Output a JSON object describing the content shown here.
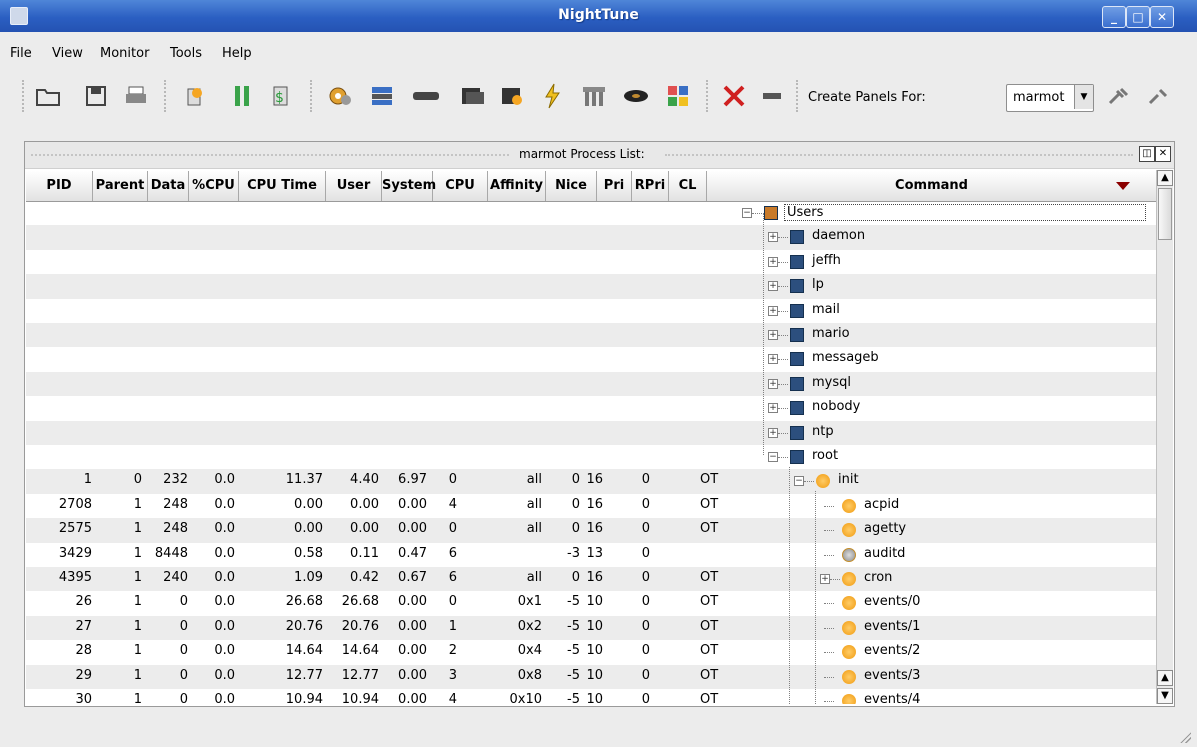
{
  "window": {
    "title": "NightTune"
  },
  "menu": [
    "File",
    "View",
    "Monitor",
    "Tools",
    "Help"
  ],
  "toolbar": {
    "buttons": [
      "open-icon",
      "save-icon",
      "print-icon",
      "refresh-icon",
      "pause-icon",
      "update-icon",
      "gear-icon",
      "network-icon",
      "memory-icon",
      "cpu-icon",
      "cpu2-icon",
      "interrupt-icon",
      "disk-icon",
      "drive-icon",
      "share-icon",
      "delete-icon",
      "connect-icon",
      "plug-icon",
      "unplug-icon"
    ],
    "create_panels_label": "Create Panels For:",
    "create_panels_value": "marmot"
  },
  "panel": {
    "title": "marmot Process List:",
    "columns": [
      "PID",
      "Parent",
      "Data",
      "%CPU",
      "CPU Time",
      "User",
      "System",
      "CPU",
      "Affinity",
      "Nice",
      "Pri",
      "RPri",
      "CL",
      "Command"
    ],
    "rows": [
      {
        "pid": "",
        "parent": "",
        "data": "",
        "cpu": "",
        "cputime": "",
        "user": "",
        "system": "",
        "cpun": "",
        "affinity": "",
        "nice": "",
        "pri": "",
        "rpri": "",
        "cl": "",
        "cmd": "Users",
        "depth": 0,
        "kind": "users",
        "exp": "-"
      },
      {
        "pid": "",
        "parent": "",
        "data": "",
        "cpu": "",
        "cputime": "",
        "user": "",
        "system": "",
        "cpun": "",
        "affinity": "",
        "nice": "",
        "pri": "",
        "rpri": "",
        "cl": "",
        "cmd": "daemon",
        "depth": 1,
        "kind": "user",
        "exp": "+"
      },
      {
        "pid": "",
        "parent": "",
        "data": "",
        "cpu": "",
        "cputime": "",
        "user": "",
        "system": "",
        "cpun": "",
        "affinity": "",
        "nice": "",
        "pri": "",
        "rpri": "",
        "cl": "",
        "cmd": "jeffh",
        "depth": 1,
        "kind": "user",
        "exp": "+"
      },
      {
        "pid": "",
        "parent": "",
        "data": "",
        "cpu": "",
        "cputime": "",
        "user": "",
        "system": "",
        "cpun": "",
        "affinity": "",
        "nice": "",
        "pri": "",
        "rpri": "",
        "cl": "",
        "cmd": "lp",
        "depth": 1,
        "kind": "user",
        "exp": "+"
      },
      {
        "pid": "",
        "parent": "",
        "data": "",
        "cpu": "",
        "cputime": "",
        "user": "",
        "system": "",
        "cpun": "",
        "affinity": "",
        "nice": "",
        "pri": "",
        "rpri": "",
        "cl": "",
        "cmd": "mail",
        "depth": 1,
        "kind": "user",
        "exp": "+"
      },
      {
        "pid": "",
        "parent": "",
        "data": "",
        "cpu": "",
        "cputime": "",
        "user": "",
        "system": "",
        "cpun": "",
        "affinity": "",
        "nice": "",
        "pri": "",
        "rpri": "",
        "cl": "",
        "cmd": "mario",
        "depth": 1,
        "kind": "user",
        "exp": "+"
      },
      {
        "pid": "",
        "parent": "",
        "data": "",
        "cpu": "",
        "cputime": "",
        "user": "",
        "system": "",
        "cpun": "",
        "affinity": "",
        "nice": "",
        "pri": "",
        "rpri": "",
        "cl": "",
        "cmd": "messageb",
        "depth": 1,
        "kind": "user",
        "exp": "+"
      },
      {
        "pid": "",
        "parent": "",
        "data": "",
        "cpu": "",
        "cputime": "",
        "user": "",
        "system": "",
        "cpun": "",
        "affinity": "",
        "nice": "",
        "pri": "",
        "rpri": "",
        "cl": "",
        "cmd": "mysql",
        "depth": 1,
        "kind": "user",
        "exp": "+"
      },
      {
        "pid": "",
        "parent": "",
        "data": "",
        "cpu": "",
        "cputime": "",
        "user": "",
        "system": "",
        "cpun": "",
        "affinity": "",
        "nice": "",
        "pri": "",
        "rpri": "",
        "cl": "",
        "cmd": "nobody",
        "depth": 1,
        "kind": "user",
        "exp": "+"
      },
      {
        "pid": "",
        "parent": "",
        "data": "",
        "cpu": "",
        "cputime": "",
        "user": "",
        "system": "",
        "cpun": "",
        "affinity": "",
        "nice": "",
        "pri": "",
        "rpri": "",
        "cl": "",
        "cmd": "ntp",
        "depth": 1,
        "kind": "user",
        "exp": "+"
      },
      {
        "pid": "",
        "parent": "",
        "data": "",
        "cpu": "",
        "cputime": "",
        "user": "",
        "system": "",
        "cpun": "",
        "affinity": "",
        "nice": "",
        "pri": "",
        "rpri": "",
        "cl": "",
        "cmd": "root",
        "depth": 1,
        "kind": "user",
        "exp": "-"
      },
      {
        "pid": "1",
        "parent": "0",
        "data": "232",
        "cpu": "0.0",
        "cputime": "11.37",
        "user": "4.40",
        "system": "6.97",
        "cpun": "0",
        "affinity": "all",
        "nice": "0",
        "pri": "16",
        "rpri": "0",
        "cl": "OT",
        "cmd": "init",
        "depth": 2,
        "kind": "proc",
        "exp": "-"
      },
      {
        "pid": "2708",
        "parent": "1",
        "data": "248",
        "cpu": "0.0",
        "cputime": "0.00",
        "user": "0.00",
        "system": "0.00",
        "cpun": "4",
        "affinity": "all",
        "nice": "0",
        "pri": "16",
        "rpri": "0",
        "cl": "OT",
        "cmd": "acpid",
        "depth": 3,
        "kind": "proc",
        "exp": ""
      },
      {
        "pid": "2575",
        "parent": "1",
        "data": "248",
        "cpu": "0.0",
        "cputime": "0.00",
        "user": "0.00",
        "system": "0.00",
        "cpun": "0",
        "affinity": "all",
        "nice": "0",
        "pri": "16",
        "rpri": "0",
        "cl": "OT",
        "cmd": "agetty",
        "depth": 3,
        "kind": "proc",
        "exp": ""
      },
      {
        "pid": "3429",
        "parent": "1",
        "data": "8448",
        "cpu": "0.0",
        "cputime": "0.58",
        "user": "0.11",
        "system": "0.47",
        "cpun": "6",
        "affinity": "",
        "nice": "-3",
        "pri": "13",
        "rpri": "0",
        "cl": "",
        "cmd": "auditd",
        "depth": 3,
        "kind": "proc-gray",
        "exp": ""
      },
      {
        "pid": "4395",
        "parent": "1",
        "data": "240",
        "cpu": "0.0",
        "cputime": "1.09",
        "user": "0.42",
        "system": "0.67",
        "cpun": "6",
        "affinity": "all",
        "nice": "0",
        "pri": "16",
        "rpri": "0",
        "cl": "OT",
        "cmd": "cron",
        "depth": 3,
        "kind": "proc",
        "exp": "+"
      },
      {
        "pid": "26",
        "parent": "1",
        "data": "0",
        "cpu": "0.0",
        "cputime": "26.68",
        "user": "26.68",
        "system": "0.00",
        "cpun": "0",
        "affinity": "0x1",
        "nice": "-5",
        "pri": "10",
        "rpri": "0",
        "cl": "OT",
        "cmd": "events/0",
        "depth": 3,
        "kind": "proc",
        "exp": ""
      },
      {
        "pid": "27",
        "parent": "1",
        "data": "0",
        "cpu": "0.0",
        "cputime": "20.76",
        "user": "20.76",
        "system": "0.00",
        "cpun": "1",
        "affinity": "0x2",
        "nice": "-5",
        "pri": "10",
        "rpri": "0",
        "cl": "OT",
        "cmd": "events/1",
        "depth": 3,
        "kind": "proc",
        "exp": ""
      },
      {
        "pid": "28",
        "parent": "1",
        "data": "0",
        "cpu": "0.0",
        "cputime": "14.64",
        "user": "14.64",
        "system": "0.00",
        "cpun": "2",
        "affinity": "0x4",
        "nice": "-5",
        "pri": "10",
        "rpri": "0",
        "cl": "OT",
        "cmd": "events/2",
        "depth": 3,
        "kind": "proc",
        "exp": ""
      },
      {
        "pid": "29",
        "parent": "1",
        "data": "0",
        "cpu": "0.0",
        "cputime": "12.77",
        "user": "12.77",
        "system": "0.00",
        "cpun": "3",
        "affinity": "0x8",
        "nice": "-5",
        "pri": "10",
        "rpri": "0",
        "cl": "OT",
        "cmd": "events/3",
        "depth": 3,
        "kind": "proc",
        "exp": ""
      },
      {
        "pid": "30",
        "parent": "1",
        "data": "0",
        "cpu": "0.0",
        "cputime": "10.94",
        "user": "10.94",
        "system": "0.00",
        "cpun": "4",
        "affinity": "0x10",
        "nice": "-5",
        "pri": "10",
        "rpri": "0",
        "cl": "OT",
        "cmd": "events/4",
        "depth": 3,
        "kind": "proc",
        "exp": ""
      }
    ]
  }
}
